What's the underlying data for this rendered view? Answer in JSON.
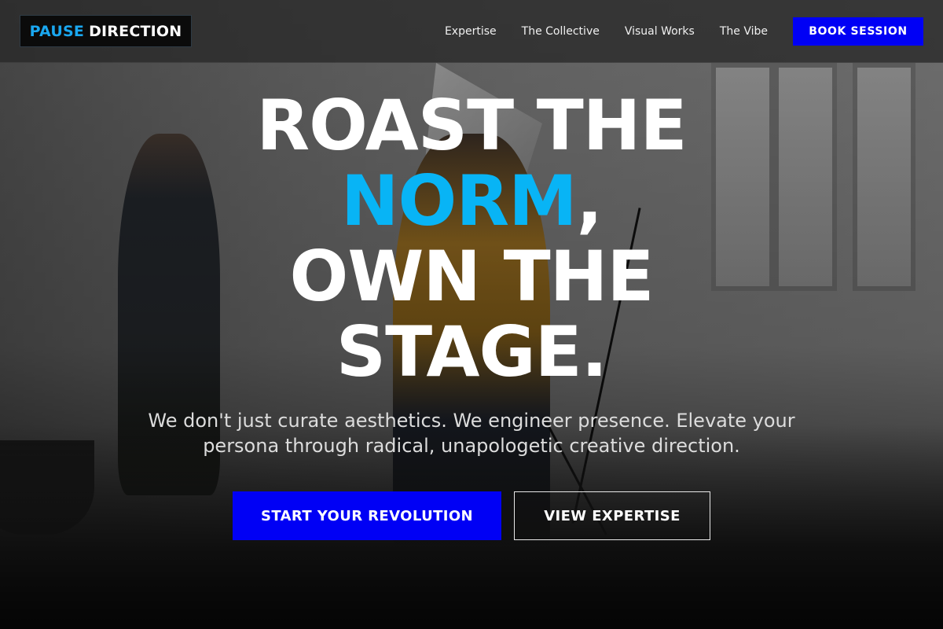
{
  "brand": {
    "part1": "PAUSE",
    "part2": "DIRECTION"
  },
  "nav": {
    "links": [
      "Expertise",
      "The Collective",
      "Visual Works",
      "The Vibe"
    ],
    "cta": "BOOK SESSION"
  },
  "hero": {
    "title_line1": "ROAST THE",
    "title_accent": "NORM",
    "title_comma": ",",
    "title_line3": "OWN THE",
    "title_line4": "STAGE.",
    "subtitle": "We don't just curate aesthetics. We engineer presence. Elevate your persona through radical, unapologetic creative direction.",
    "primary_button": "START YOUR REVOLUTION",
    "secondary_button": "VIEW EXPERTISE"
  },
  "colors": {
    "accent_blue": "#08b4f5",
    "button_blue": "#0000f5",
    "header_bg": "#282828"
  }
}
